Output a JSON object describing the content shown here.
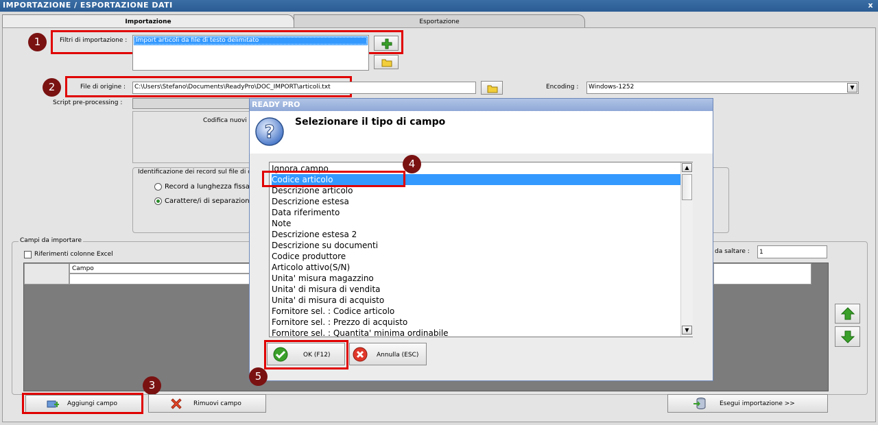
{
  "window": {
    "title": "IMPORTAZIONE / ESPORTAZIONE DATI",
    "close": "x"
  },
  "tabs": [
    {
      "label": "Importazione"
    },
    {
      "label": "Esportazione"
    }
  ],
  "import_filters": {
    "label": "Filtri di importazione :",
    "selected": "Import articoli da file di testo delimitato"
  },
  "origin_file": {
    "label": "File di origine :",
    "value": "C:\\Users\\Stefano\\Documents\\ReadyPro\\DOC_IMPORT\\articoli.txt"
  },
  "encoding": {
    "label": "Encoding :",
    "value": "Windows-1252"
  },
  "script_label": "Script pre-processing :",
  "codifica_label": "Codifica nuovi",
  "record_id": {
    "label": "Identificazione dei record sul file di d",
    "options": [
      {
        "label": "Record a lunghezza fissa",
        "checked": false
      },
      {
        "label": "Carattere/i di separazione",
        "checked": true
      }
    ]
  },
  "fields_section": {
    "label": "Campi da importare",
    "excel_checkbox": "Riferimenti colonne Excel",
    "column_header": "Campo",
    "skip_label": "da saltare :",
    "skip_value": "1"
  },
  "bottom_buttons": {
    "add": "Aggiungi campo",
    "remove": "Rimuovi campo",
    "run": "Esegui importazione >>"
  },
  "dialog": {
    "title": "READY PRO",
    "question": "Selezionare il tipo di campo",
    "items": [
      "Ignora campo",
      "Codice articolo",
      "Descrizione articolo",
      "Descrizione estesa",
      "Data riferimento",
      "Note",
      "Descrizione estesa 2",
      "Descrizione su documenti",
      "Codice produttore",
      "Articolo attivo(S/N)",
      "Unita' misura magazzino",
      "Unita' di misura di vendita",
      "Unita' di misura di acquisto",
      "Fornitore sel. : Codice articolo",
      "Fornitore sel. : Prezzo di acquisto",
      "Fornitore sel. : Quantita' minima ordinabile"
    ],
    "selected": "Codice articolo",
    "ok": "OK (F12)",
    "cancel": "Annulla (ESC)"
  },
  "badges": [
    "1",
    "2",
    "3",
    "4",
    "5"
  ],
  "colors": {
    "titlebar": "#2b5d94",
    "selection": "#3399ff",
    "highlight": "#e00000",
    "badge": "#7a1212"
  }
}
